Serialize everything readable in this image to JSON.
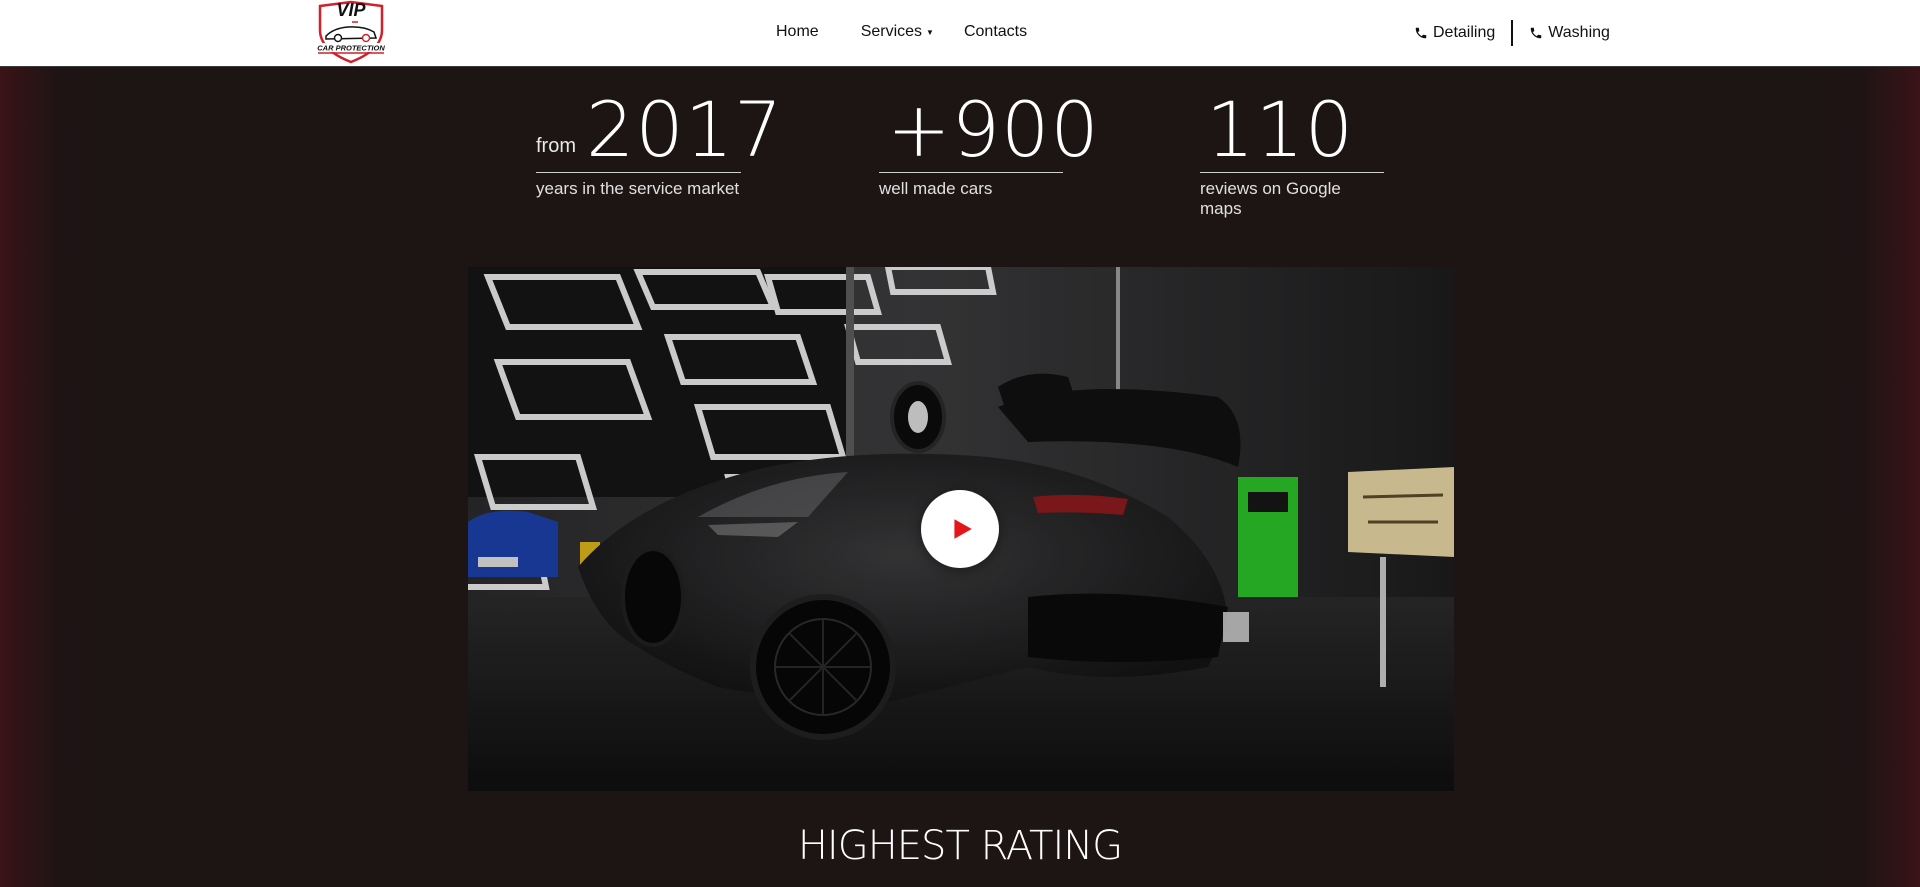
{
  "header": {
    "logo": {
      "name": "vip-car-protection-logo",
      "text_top": "VIP",
      "text_bottom": "CAR PROTECTION"
    },
    "nav": {
      "home": "Home",
      "services": "Services",
      "contacts": "Contacts"
    },
    "phones": {
      "detailing": "Detailing",
      "washing": "Washing"
    }
  },
  "stats": [
    {
      "prefix": "from",
      "number": "2017",
      "label": "years in the service market"
    },
    {
      "prefix": "",
      "number": "+900",
      "label": "well made cars"
    },
    {
      "prefix": "",
      "number": "110",
      "label": "reviews on Google maps"
    }
  ],
  "video": {
    "thumbnail": "black supercar in detailing garage with hexagonal LED ceiling lights",
    "play_icon": "play-icon"
  },
  "section": {
    "title": "HIGHEST RATING"
  },
  "colors": {
    "background": "#1d1414",
    "edge_red": "#3a1317",
    "header_bg": "#ffffff",
    "play_red": "#e3161c",
    "logo_red": "#d0202a"
  }
}
